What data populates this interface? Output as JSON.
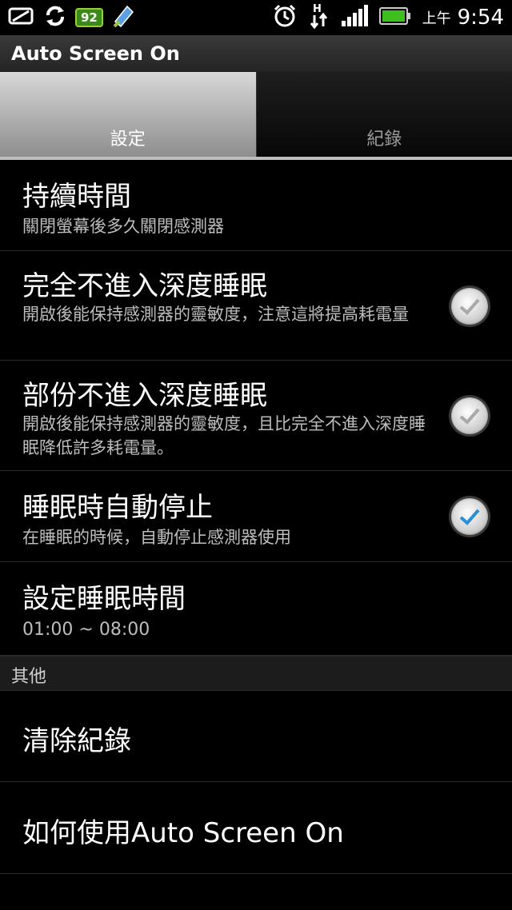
{
  "status_bar": {
    "battery_badge": "92",
    "ampm": "上午",
    "time": "9:54"
  },
  "app": {
    "title": "Auto Screen On"
  },
  "tabs": [
    {
      "label": "設定",
      "active": true
    },
    {
      "label": "紀錄",
      "active": false
    }
  ],
  "settings": [
    {
      "title": "持續時間",
      "summary": "關閉螢幕後多久關閉感測器"
    },
    {
      "title": "完全不進入深度睡眠",
      "summary": "開啟後能保持感測器的靈敏度，注意這將提高耗電量",
      "checked": false
    },
    {
      "title": "部份不進入深度睡眠",
      "summary": "開啟後能保持感測器的靈敏度，且比完全不進入深度睡眠降低許多耗電量。",
      "checked": false
    },
    {
      "title": "睡眠時自動停止",
      "summary": "在睡眠的時候，自動停止感測器使用",
      "checked": true
    },
    {
      "title": "設定睡眠時間",
      "summary": "01:00 ~ 08:00"
    }
  ],
  "section_other": "其他",
  "other_items": [
    {
      "title": "清除紀錄"
    },
    {
      "title": "如何使用Auto Screen On"
    }
  ],
  "colors": {
    "accent_check": "#2a8fd6",
    "tab_active": "#bdbdbd"
  }
}
